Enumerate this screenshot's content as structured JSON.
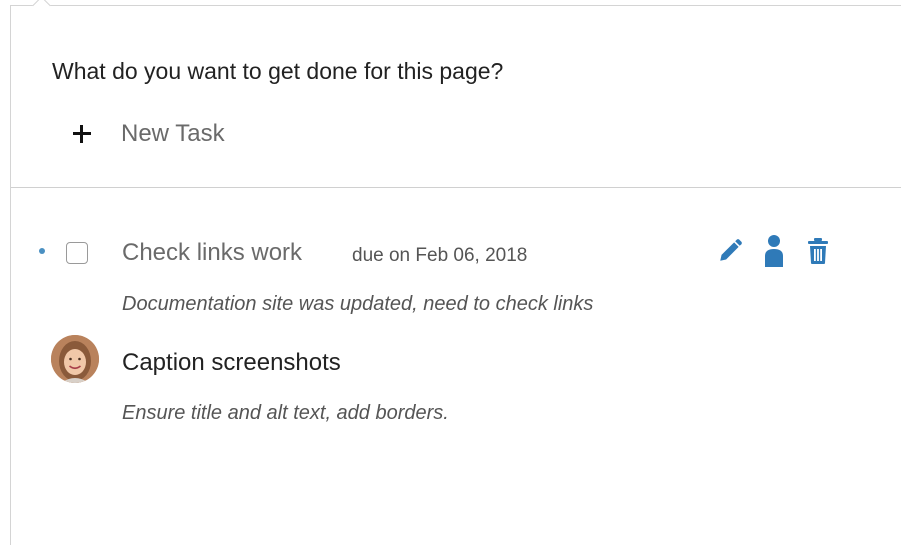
{
  "prompt": "What do you want to get done for this page?",
  "new_task": {
    "label": "New Task",
    "icon": "plus-icon"
  },
  "tasks": [
    {
      "title": "Check links work",
      "due": "due on Feb 06, 2018",
      "description": "Documentation site was updated, need to check links",
      "completed": false,
      "actions": [
        "pencil-icon",
        "person-icon",
        "trash-icon"
      ]
    },
    {
      "title": "Caption screenshots",
      "description": "Ensure title and alt text, add borders.",
      "assignee_avatar": "avatar"
    }
  ],
  "colors": {
    "accent": "#2f7ab8",
    "bullet": "#4a90c2",
    "divider": "#d0d0d0"
  }
}
